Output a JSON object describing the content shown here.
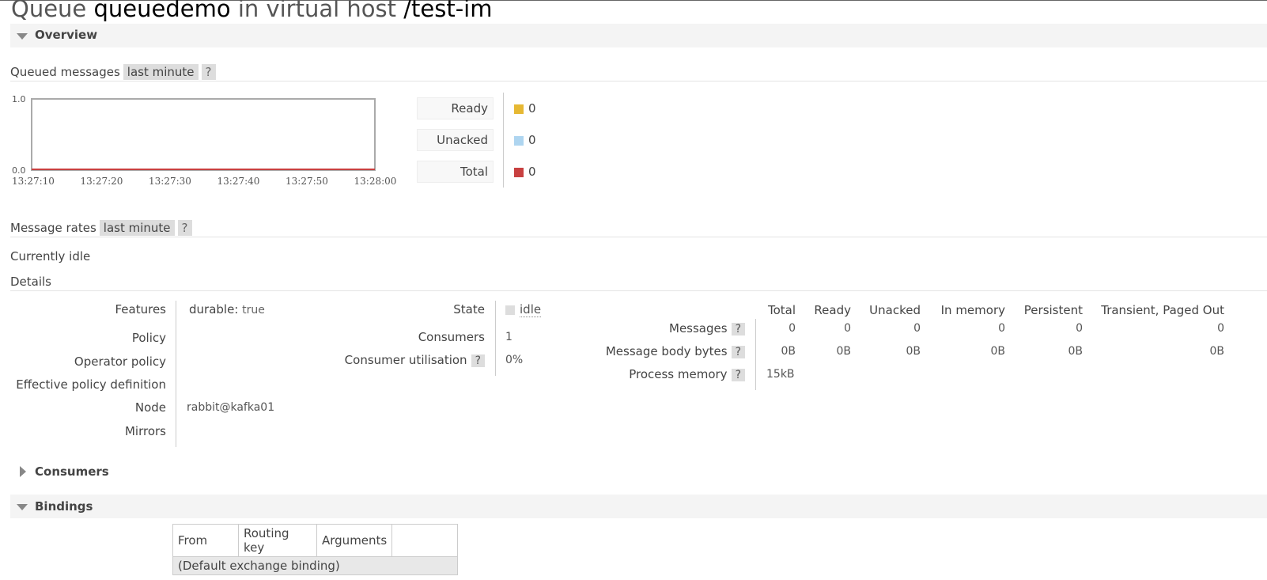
{
  "page": {
    "title_prefix": "Queue",
    "queue_name": "queuedemo",
    "title_mid": "in virtual host",
    "vhost": "/test-im"
  },
  "sections": {
    "overview": "Overview",
    "consumers": "Consumers",
    "bindings": "Bindings"
  },
  "queued_messages": {
    "label": "Queued messages",
    "range": "last minute",
    "help": "?",
    "legend": [
      {
        "label": "Ready",
        "value": "0",
        "color": "#e6b833"
      },
      {
        "label": "Unacked",
        "value": "0",
        "color": "#aed5f0"
      },
      {
        "label": "Total",
        "value": "0",
        "color": "#c84040"
      }
    ]
  },
  "chart_data": {
    "type": "line",
    "x": [
      "13:27:10",
      "13:27:20",
      "13:27:30",
      "13:27:40",
      "13:27:50",
      "13:28:00"
    ],
    "ylim": [
      0.0,
      1.0
    ],
    "y_ticks": [
      "1.0",
      "0.0"
    ],
    "series": [
      {
        "name": "Ready",
        "values": [
          0,
          0,
          0,
          0,
          0,
          0
        ],
        "color": "#e6b833"
      },
      {
        "name": "Unacked",
        "values": [
          0,
          0,
          0,
          0,
          0,
          0
        ],
        "color": "#aed5f0"
      },
      {
        "name": "Total",
        "values": [
          0,
          0,
          0,
          0,
          0,
          0
        ],
        "color": "#c84040"
      }
    ]
  },
  "message_rates": {
    "label": "Message rates",
    "range": "last minute",
    "help": "?",
    "status": "Currently idle"
  },
  "details": {
    "label": "Details",
    "features_label": "Features",
    "features_key": "durable:",
    "features_value": "true",
    "policy_label": "Policy",
    "operator_policy_label": "Operator policy",
    "effective_policy_label": "Effective policy definition",
    "node_label": "Node",
    "node_value": "rabbit@kafka01",
    "mirrors_label": "Mirrors",
    "state_label": "State",
    "state_value": "idle",
    "consumers_label": "Consumers",
    "consumers_value": "1",
    "consumer_util_label": "Consumer utilisation",
    "consumer_util_value": "0%",
    "help": "?"
  },
  "stats": {
    "headers": [
      "Total",
      "Ready",
      "Unacked",
      "In memory",
      "Persistent",
      "Transient, Paged Out"
    ],
    "rows": [
      {
        "label": "Messages",
        "values": [
          "0",
          "0",
          "0",
          "0",
          "0",
          "0"
        ]
      },
      {
        "label": "Message body bytes",
        "values": [
          "0B",
          "0B",
          "0B",
          "0B",
          "0B",
          "0B"
        ]
      },
      {
        "label": "Process memory",
        "values": [
          "15kB",
          "",
          "",
          "",
          "",
          ""
        ]
      }
    ]
  },
  "bindings": {
    "headers": [
      "From",
      "Routing key",
      "Arguments",
      ""
    ],
    "default_row": "(Default exchange binding)"
  }
}
